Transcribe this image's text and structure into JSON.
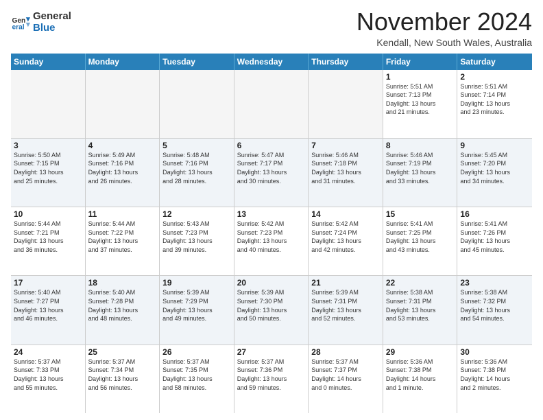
{
  "logo": {
    "general": "General",
    "blue": "Blue"
  },
  "title": "November 2024",
  "location": "Kendall, New South Wales, Australia",
  "days_of_week": [
    "Sunday",
    "Monday",
    "Tuesday",
    "Wednesday",
    "Thursday",
    "Friday",
    "Saturday"
  ],
  "weeks": [
    [
      {
        "day": "",
        "info": ""
      },
      {
        "day": "",
        "info": ""
      },
      {
        "day": "",
        "info": ""
      },
      {
        "day": "",
        "info": ""
      },
      {
        "day": "",
        "info": ""
      },
      {
        "day": "1",
        "info": "Sunrise: 5:51 AM\nSunset: 7:13 PM\nDaylight: 13 hours\nand 21 minutes."
      },
      {
        "day": "2",
        "info": "Sunrise: 5:51 AM\nSunset: 7:14 PM\nDaylight: 13 hours\nand 23 minutes."
      }
    ],
    [
      {
        "day": "3",
        "info": "Sunrise: 5:50 AM\nSunset: 7:15 PM\nDaylight: 13 hours\nand 25 minutes."
      },
      {
        "day": "4",
        "info": "Sunrise: 5:49 AM\nSunset: 7:16 PM\nDaylight: 13 hours\nand 26 minutes."
      },
      {
        "day": "5",
        "info": "Sunrise: 5:48 AM\nSunset: 7:16 PM\nDaylight: 13 hours\nand 28 minutes."
      },
      {
        "day": "6",
        "info": "Sunrise: 5:47 AM\nSunset: 7:17 PM\nDaylight: 13 hours\nand 30 minutes."
      },
      {
        "day": "7",
        "info": "Sunrise: 5:46 AM\nSunset: 7:18 PM\nDaylight: 13 hours\nand 31 minutes."
      },
      {
        "day": "8",
        "info": "Sunrise: 5:46 AM\nSunset: 7:19 PM\nDaylight: 13 hours\nand 33 minutes."
      },
      {
        "day": "9",
        "info": "Sunrise: 5:45 AM\nSunset: 7:20 PM\nDaylight: 13 hours\nand 34 minutes."
      }
    ],
    [
      {
        "day": "10",
        "info": "Sunrise: 5:44 AM\nSunset: 7:21 PM\nDaylight: 13 hours\nand 36 minutes."
      },
      {
        "day": "11",
        "info": "Sunrise: 5:44 AM\nSunset: 7:22 PM\nDaylight: 13 hours\nand 37 minutes."
      },
      {
        "day": "12",
        "info": "Sunrise: 5:43 AM\nSunset: 7:23 PM\nDaylight: 13 hours\nand 39 minutes."
      },
      {
        "day": "13",
        "info": "Sunrise: 5:42 AM\nSunset: 7:23 PM\nDaylight: 13 hours\nand 40 minutes."
      },
      {
        "day": "14",
        "info": "Sunrise: 5:42 AM\nSunset: 7:24 PM\nDaylight: 13 hours\nand 42 minutes."
      },
      {
        "day": "15",
        "info": "Sunrise: 5:41 AM\nSunset: 7:25 PM\nDaylight: 13 hours\nand 43 minutes."
      },
      {
        "day": "16",
        "info": "Sunrise: 5:41 AM\nSunset: 7:26 PM\nDaylight: 13 hours\nand 45 minutes."
      }
    ],
    [
      {
        "day": "17",
        "info": "Sunrise: 5:40 AM\nSunset: 7:27 PM\nDaylight: 13 hours\nand 46 minutes."
      },
      {
        "day": "18",
        "info": "Sunrise: 5:40 AM\nSunset: 7:28 PM\nDaylight: 13 hours\nand 48 minutes."
      },
      {
        "day": "19",
        "info": "Sunrise: 5:39 AM\nSunset: 7:29 PM\nDaylight: 13 hours\nand 49 minutes."
      },
      {
        "day": "20",
        "info": "Sunrise: 5:39 AM\nSunset: 7:30 PM\nDaylight: 13 hours\nand 50 minutes."
      },
      {
        "day": "21",
        "info": "Sunrise: 5:39 AM\nSunset: 7:31 PM\nDaylight: 13 hours\nand 52 minutes."
      },
      {
        "day": "22",
        "info": "Sunrise: 5:38 AM\nSunset: 7:31 PM\nDaylight: 13 hours\nand 53 minutes."
      },
      {
        "day": "23",
        "info": "Sunrise: 5:38 AM\nSunset: 7:32 PM\nDaylight: 13 hours\nand 54 minutes."
      }
    ],
    [
      {
        "day": "24",
        "info": "Sunrise: 5:37 AM\nSunset: 7:33 PM\nDaylight: 13 hours\nand 55 minutes."
      },
      {
        "day": "25",
        "info": "Sunrise: 5:37 AM\nSunset: 7:34 PM\nDaylight: 13 hours\nand 56 minutes."
      },
      {
        "day": "26",
        "info": "Sunrise: 5:37 AM\nSunset: 7:35 PM\nDaylight: 13 hours\nand 58 minutes."
      },
      {
        "day": "27",
        "info": "Sunrise: 5:37 AM\nSunset: 7:36 PM\nDaylight: 13 hours\nand 59 minutes."
      },
      {
        "day": "28",
        "info": "Sunrise: 5:37 AM\nSunset: 7:37 PM\nDaylight: 14 hours\nand 0 minutes."
      },
      {
        "day": "29",
        "info": "Sunrise: 5:36 AM\nSunset: 7:38 PM\nDaylight: 14 hours\nand 1 minute."
      },
      {
        "day": "30",
        "info": "Sunrise: 5:36 AM\nSunset: 7:38 PM\nDaylight: 14 hours\nand 2 minutes."
      }
    ]
  ]
}
